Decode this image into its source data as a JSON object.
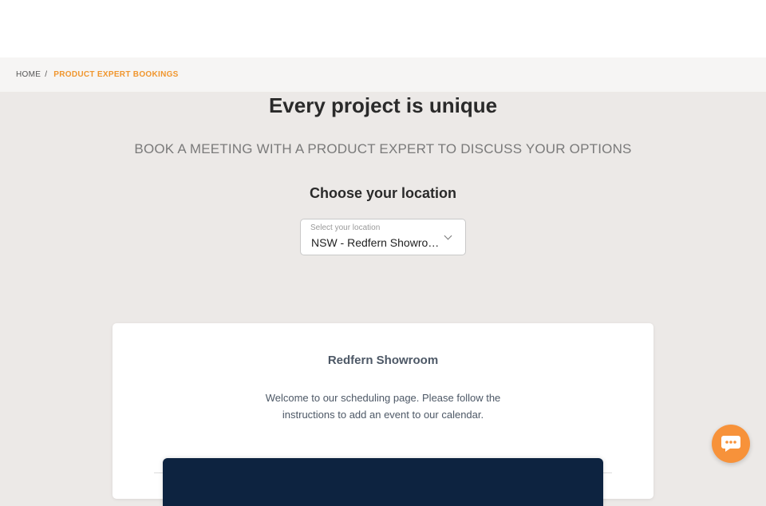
{
  "breadcrumb": {
    "home": "HOME",
    "separator": "/",
    "current": "PRODUCT EXPERT BOOKINGS"
  },
  "hero": {
    "title": "Every project is unique",
    "subtitle": "BOOK A MEETING WITH A PRODUCT EXPERT TO DISCUSS YOUR OPTIONS"
  },
  "location": {
    "heading": "Choose your location",
    "select_label": "Select your location",
    "selected_value": "NSW - Redfern Showroom"
  },
  "card": {
    "title": "Redfern Showroom",
    "welcome_text": "Welcome to our scheduling page. Please follow the instructions to add an event to our calendar."
  },
  "colors": {
    "accent": "#f0962e",
    "chat_button": "#f7923a",
    "page_background": "#ece9e7",
    "panel_dark": "#0d2340"
  },
  "icons": {
    "chat": "chat-bubble-icon",
    "dropdown": "chevron-down-icon"
  }
}
